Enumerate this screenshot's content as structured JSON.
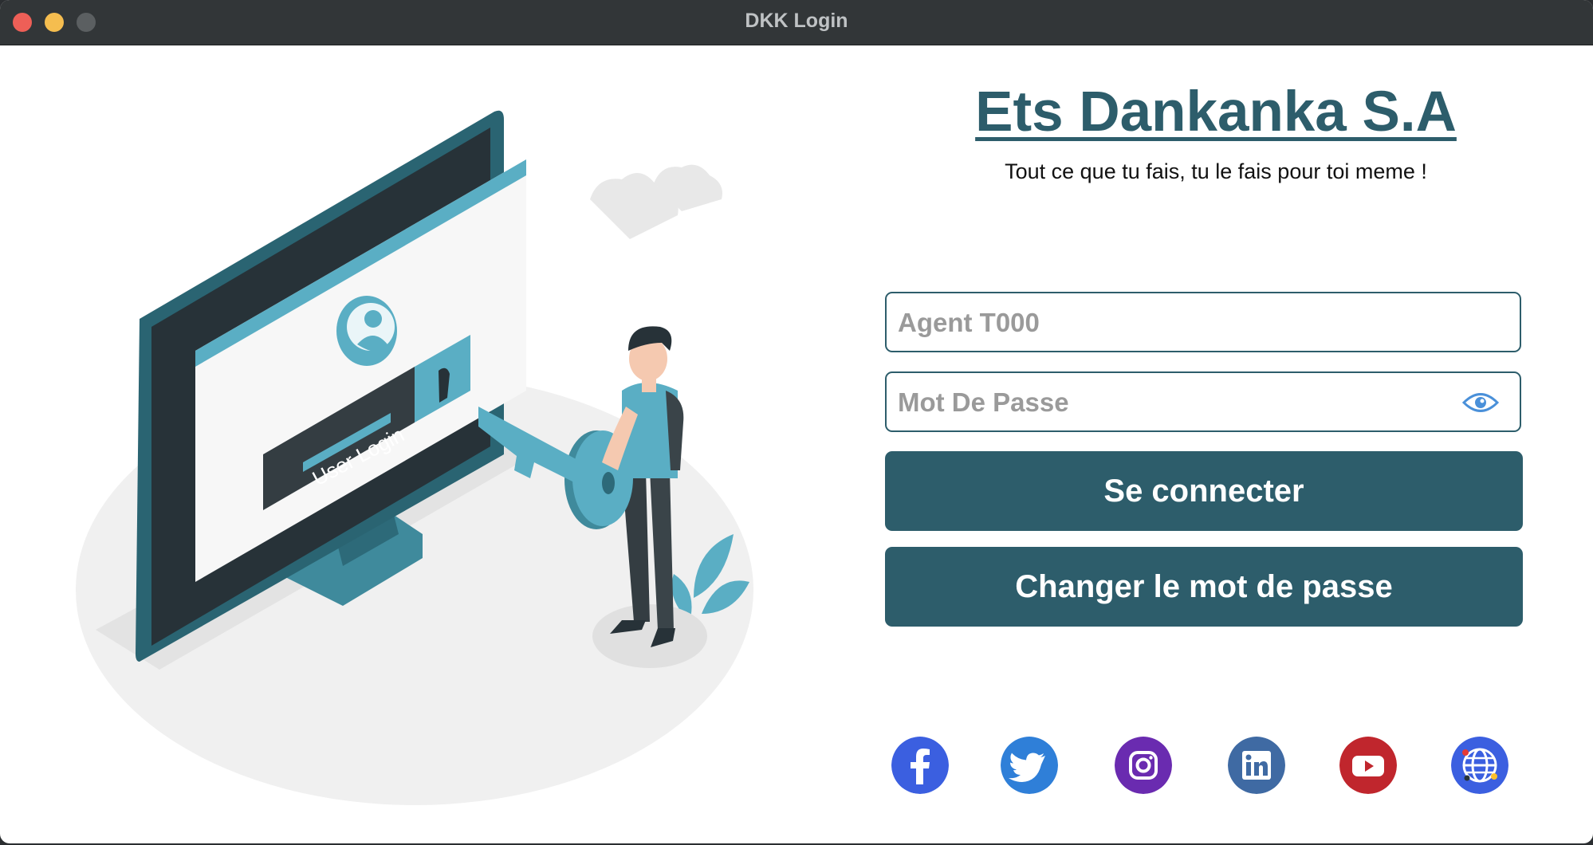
{
  "window": {
    "title": "DKK Login"
  },
  "brand": {
    "name": "Ets Dankanka S.A",
    "tagline": "Tout ce que tu fais, tu le fais pour toi meme !"
  },
  "illustration": {
    "screen_label": "User Login"
  },
  "form": {
    "username_placeholder": "Agent T000",
    "password_placeholder": "Mot De Passe",
    "login_button": "Se connecter",
    "change_password_button": "Changer le mot de passe"
  },
  "social": [
    "facebook-icon",
    "twitter-icon",
    "instagram-icon",
    "linkedin-icon",
    "youtube-icon",
    "website-globe-icon"
  ],
  "colors": {
    "accent": "#2d5d6b",
    "titlebar": "#323638"
  }
}
